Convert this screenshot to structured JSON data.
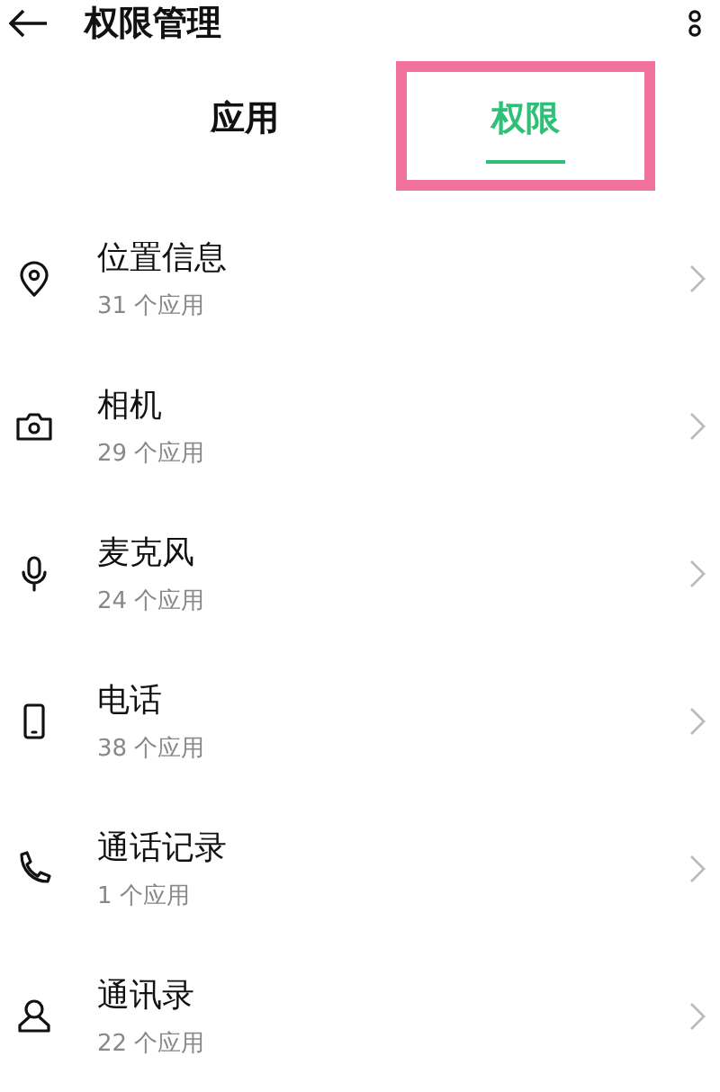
{
  "header": {
    "title": "权限管理"
  },
  "tabs": [
    {
      "label": "应用",
      "selected": false,
      "highlighted": false
    },
    {
      "label": "权限",
      "selected": true,
      "highlighted": true
    }
  ],
  "permissions": [
    {
      "kind": "location",
      "name": "位置信息",
      "count": "31 个应用"
    },
    {
      "kind": "camera",
      "name": "相机",
      "count": "29 个应用"
    },
    {
      "kind": "microphone",
      "name": "麦克风",
      "count": "24 个应用"
    },
    {
      "kind": "phone",
      "name": "电话",
      "count": "38 个应用"
    },
    {
      "kind": "call-log",
      "name": "通话记录",
      "count": "1 个应用"
    },
    {
      "kind": "contacts",
      "name": "通讯录",
      "count": "22 个应用"
    }
  ]
}
